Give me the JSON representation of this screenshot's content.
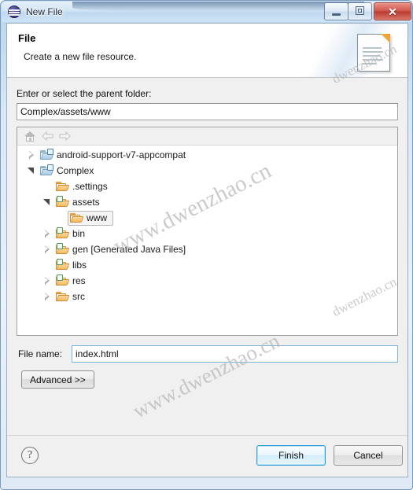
{
  "window": {
    "title": "New File",
    "app_icon": "eclipse-circle-icon",
    "controls": {
      "minimize": "minimize-icon",
      "maximize": "maximize-icon",
      "close": "✕"
    }
  },
  "banner": {
    "title": "File",
    "description": "Create a new file resource.",
    "icon": "new-file-document-icon"
  },
  "form": {
    "parent_label": "Enter or select the parent folder:",
    "parent_value": "Complex/assets/www",
    "parent_placeholder": "",
    "filename_label": "File name:",
    "filename_value": "index.html",
    "filename_placeholder": "",
    "advanced_label": "Advanced >>"
  },
  "tree": {
    "toolbar": [
      {
        "name": "home-icon",
        "enabled": false
      },
      {
        "name": "back-arrow-icon",
        "enabled": false
      },
      {
        "name": "forward-arrow-icon",
        "enabled": false
      }
    ],
    "items": [
      {
        "label": "android-support-v7-appcompat",
        "indent": 0,
        "twisty": "collapsed",
        "icon": "project-folder-icon",
        "selected": false
      },
      {
        "label": "Complex",
        "indent": 0,
        "twisty": "expanded",
        "icon": "project-folder-icon",
        "selected": false
      },
      {
        "label": ".settings",
        "indent": 1,
        "twisty": "none",
        "icon": "folder-icon",
        "selected": false
      },
      {
        "label": "assets",
        "indent": 1,
        "twisty": "expanded",
        "icon": "source-folder-icon",
        "selected": false
      },
      {
        "label": "www",
        "indent": 2,
        "twisty": "none",
        "icon": "folder-icon",
        "selected": true
      },
      {
        "label": "bin",
        "indent": 1,
        "twisty": "collapsed",
        "icon": "source-folder-icon",
        "selected": false
      },
      {
        "label": "gen [Generated Java Files]",
        "indent": 1,
        "twisty": "collapsed",
        "icon": "source-folder-icon",
        "selected": false
      },
      {
        "label": "libs",
        "indent": 1,
        "twisty": "none",
        "icon": "source-folder-icon",
        "selected": false
      },
      {
        "label": "res",
        "indent": 1,
        "twisty": "collapsed",
        "icon": "source-folder-icon",
        "selected": false
      },
      {
        "label": "src",
        "indent": 1,
        "twisty": "collapsed",
        "icon": "folder-icon",
        "selected": false
      }
    ]
  },
  "footer": {
    "help": "?",
    "finish_label": "Finish",
    "cancel_label": "Cancel"
  },
  "watermark": {
    "text": "www.dwenzhao.cn",
    "short": "dwenzhao.cn"
  },
  "colors": {
    "accent": "#2e9bd6",
    "window_frame": "#7a9bbd",
    "dialog_bg": "#f0f0f0",
    "folder_orange": "#e9a33c",
    "close_red": "#b93c31"
  }
}
